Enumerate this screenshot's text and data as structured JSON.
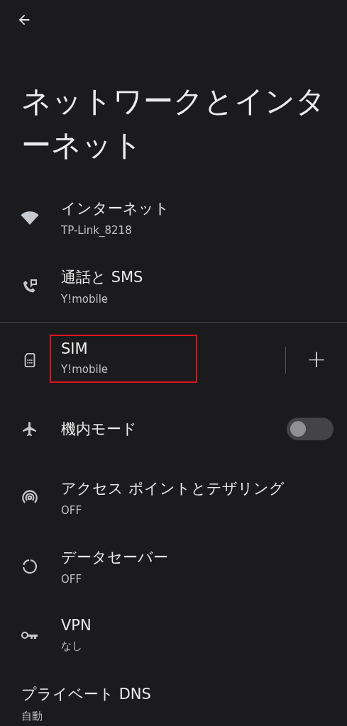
{
  "title": "ネットワークとインターネット",
  "sections": [
    {
      "items": [
        {
          "kind": "plain",
          "label": "インターネット",
          "summary": "TP-Link_8218"
        },
        {
          "kind": "plain",
          "label": "通話と SMS",
          "summary": "Y!mobile"
        }
      ]
    },
    {
      "items": [
        {
          "kind": "add",
          "label": "SIM",
          "summary": "Y!mobile",
          "highlighted": true,
          "action": "+"
        },
        {
          "kind": "toggle",
          "label": "機内モード",
          "on": false
        },
        {
          "kind": "plain",
          "label": "アクセス ポイントとテザリング",
          "summary": "OFF"
        },
        {
          "kind": "plain",
          "label": "データセーバー",
          "summary": "OFF"
        },
        {
          "kind": "plain",
          "label": "VPN",
          "summary": "なし"
        },
        {
          "kind": "noicon",
          "label": "プライベート DNS",
          "summary": "自動"
        }
      ]
    }
  ]
}
